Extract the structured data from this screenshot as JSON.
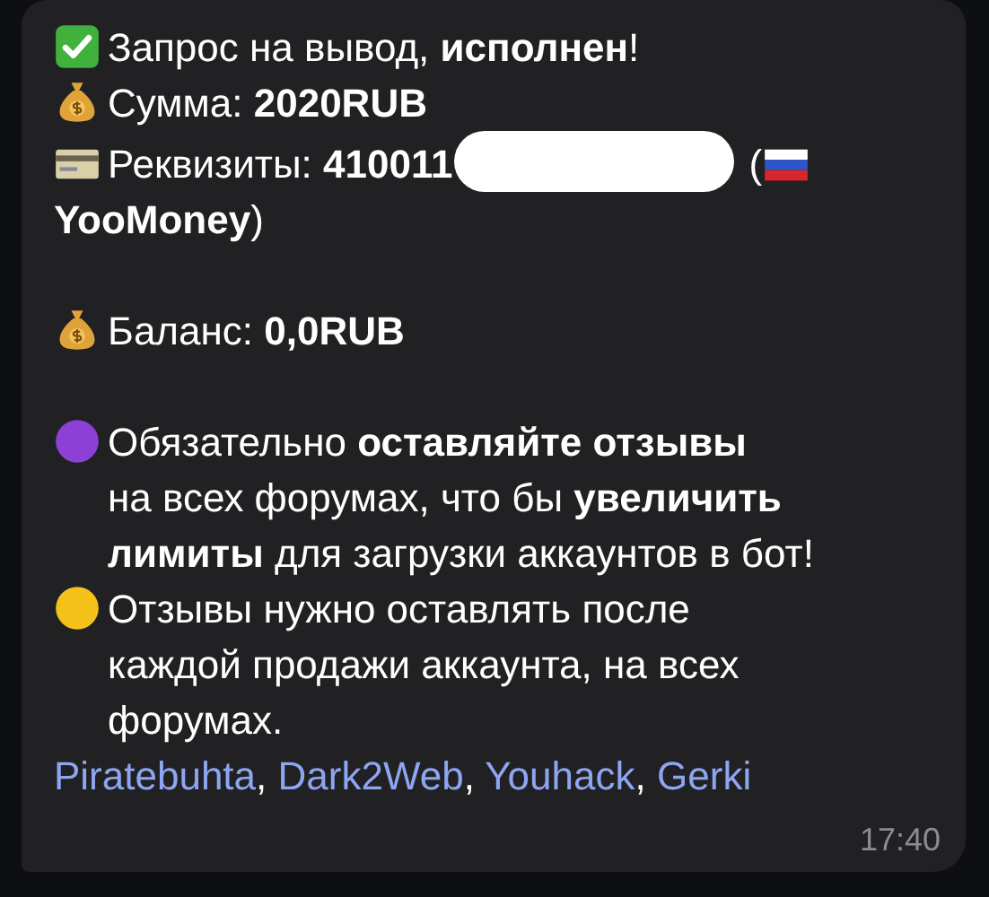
{
  "message": {
    "blocks": [
      [
        {
          "text": "Запрос на вывод, **исполнен**!"
        },
        {
          "text": "Сумма: **2020RUB**"
        },
        {
          "text": "Реквизиты: **410011**",
          "after_redaction": "(",
          "continuation": "**YooMoney**)"
        }
      ],
      [
        {
          "text": "Баланс: **0,0RUB**"
        }
      ],
      [
        {
          "text": "Обязательно **оставляйте отзывы**\nна всех форумах, что бы **увеличить\nлимиты** для загрузки аккаунтов в бот!"
        },
        {
          "text": "Отзывы нужно оставлять после\nкаждой продажи аккаунта, на всех\nфорумах."
        }
      ]
    ],
    "links": [
      {
        "text": "Piratebuhta",
        "after": ","
      },
      {
        "text": "Dark2Web",
        "after": ","
      },
      {
        "text": "Youhack",
        "after": ","
      },
      {
        "text": "Gerki"
      }
    ],
    "time": "17:40"
  }
}
